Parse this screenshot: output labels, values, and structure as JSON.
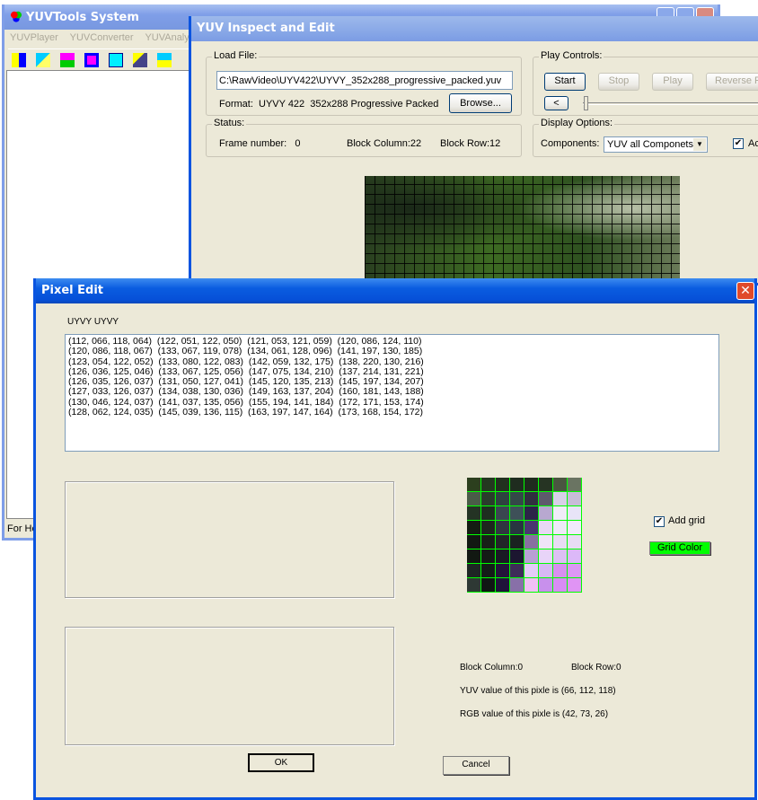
{
  "main_window": {
    "title": "YUVTools System",
    "menu": [
      "YUVPlayer",
      "YUVConverter",
      "YUVAnalyze"
    ],
    "status": "For He",
    "toolbar_icons": [
      "open-arrow-icon",
      "convert-icon",
      "convert-multi-icon",
      "frame-icon",
      "swap-icon",
      "tools-icon",
      "analyze-icon",
      "edit-grid-icon"
    ]
  },
  "inspect_window": {
    "title": "YUV Inspect and Edit",
    "load_file": {
      "label": "Load File:",
      "path": "C:\\RawVideo\\UYV422\\UYVY_352x288_progressive_packed.yuv",
      "format": "Format:  UYVY 422  352x288 Progressive Packed",
      "browse": "Browse..."
    },
    "status": {
      "label": "Status:",
      "frame": "Frame number:   0",
      "block_column": "Block Column:22",
      "block_row": "Block Row:12"
    },
    "play": {
      "label": "Play Controls:",
      "start": "Start",
      "stop": "Stop",
      "play": "Play",
      "reverse": "Reverse F",
      "prev": "<"
    },
    "display": {
      "label": "Display Options:",
      "components_label": "Components:",
      "components_value": "YUV all Componets",
      "checkbox_label": "Ac",
      "checked": true
    }
  },
  "pixel_edit": {
    "title": "Pixel Edit",
    "data_label": "UYVY UYVY",
    "rows": [
      "(112, 066, 118, 064)  (122, 051, 122, 050)  (121, 053, 121, 059)  (120, 086, 124, 110)",
      "(120, 086, 118, 067)  (133, 067, 119, 078)  (134, 061, 128, 096)  (141, 197, 130, 185)",
      "(123, 054, 122, 052)  (133, 080, 122, 083)  (142, 059, 132, 175)  (138, 220, 130, 216)",
      "(126, 036, 125, 046)  (133, 067, 125, 056)  (147, 075, 134, 210)  (137, 214, 131, 221)",
      "(126, 035, 126, 037)  (131, 050, 127, 041)  (145, 120, 135, 213)  (145, 197, 134, 207)",
      "(127, 033, 126, 037)  (134, 038, 130, 036)  (149, 163, 137, 204)  (160, 181, 143, 188)",
      "(130, 046, 124, 037)  (141, 037, 135, 056)  (155, 194, 141, 184)  (172, 171, 153, 174)",
      "(128, 062, 124, 035)  (145, 039, 136, 115)  (163, 197, 147, 164)  (173, 168, 154, 172)"
    ],
    "add_grid": "Add grid",
    "add_grid_checked": true,
    "grid_color_button": "Grid Color",
    "grid_color": "#00ff00",
    "block_column": "Block Column:0",
    "block_row": "Block Row:0",
    "yuv_value": "YUV value of this pixle is (66, 112, 118)",
    "rgb_value": "RGB value of this pixle is (42, 73, 26)",
    "ok": "OK",
    "cancel": "Cancel",
    "pixel_colors": [
      [
        "#2c3f1e",
        "#243820",
        "#22301f",
        "#1f2c1f",
        "#1f2a1e",
        "#263423",
        "#4a5540",
        "#6a7462"
      ],
      [
        "#4a5c48",
        "#2a3c2c",
        "#2e4240",
        "#344848",
        "#302f3f",
        "#5e5a6c",
        "#d8d0e8",
        "#c8bcd8"
      ],
      [
        "#243324",
        "#1e2e20",
        "#3a4650",
        "#3e5058",
        "#2c2448",
        "#b8a8d0",
        "#f0ecf8",
        "#e8e4f8"
      ],
      [
        "#141c12",
        "#1e261e",
        "#303640",
        "#283640",
        "#4a3670",
        "#e8d8f4",
        "#eeeaf8",
        "#f0eafc"
      ],
      [
        "#121812",
        "#182018",
        "#222628",
        "#1a2220",
        "#8870a0",
        "#f0e4f8",
        "#e8dcf4",
        "#e8dcf4"
      ],
      [
        "#121812",
        "#141a16",
        "#1a1a24",
        "#1c1630",
        "#b8a0d4",
        "#e8d4f8",
        "#dcc0f4",
        "#dcb8f8"
      ],
      [
        "#1e2624",
        "#141c18",
        "#24143a",
        "#3e2c58",
        "#e4ccf8",
        "#d8b8f4",
        "#d890f0",
        "#dc98f4"
      ],
      [
        "#2e3834",
        "#101614",
        "#20143a",
        "#8870a8",
        "#f0c0f4",
        "#c890ec",
        "#d88cf4",
        "#e094f4"
      ]
    ]
  }
}
